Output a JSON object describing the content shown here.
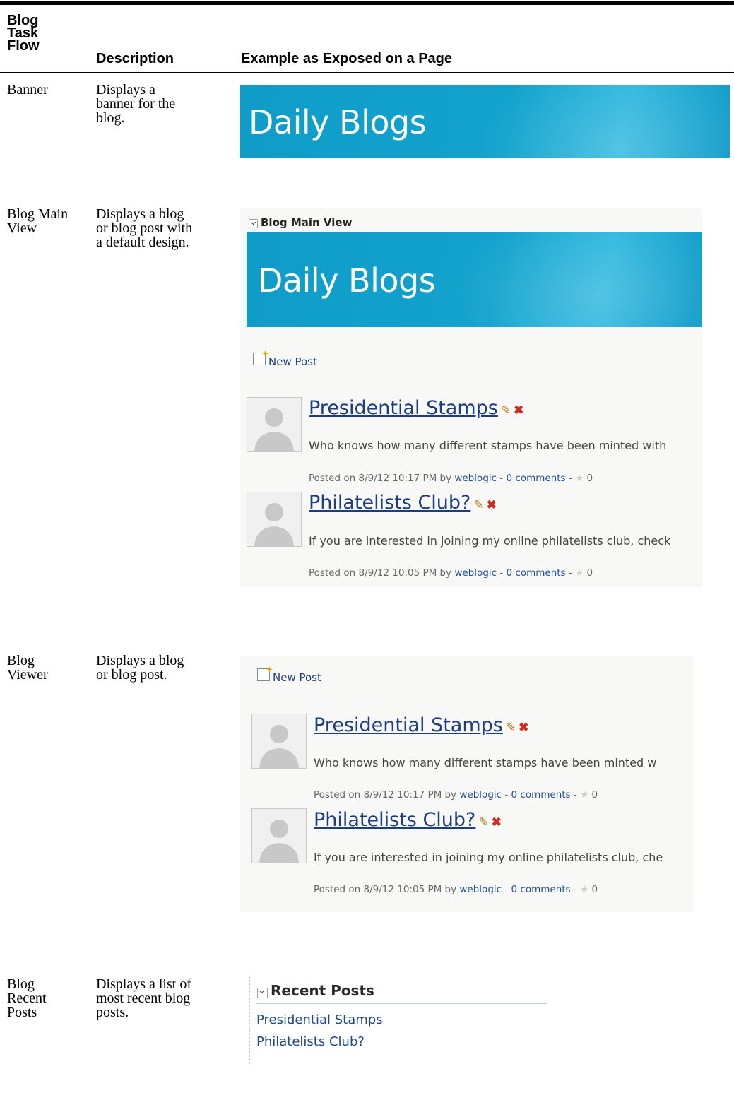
{
  "table": {
    "headers": {
      "col1": [
        "Blog",
        "Task",
        "Flow"
      ],
      "col2": "Description",
      "col3": "Example as Exposed on a Page"
    },
    "rows": [
      {
        "flow": [
          "Banner"
        ],
        "description": [
          "Displays a",
          "banner for the",
          "blog."
        ]
      },
      {
        "flow": [
          "Blog Main",
          "View"
        ],
        "description": [
          "Displays a blog",
          "or blog post with",
          "a default design."
        ]
      },
      {
        "flow": [
          "Blog",
          "Viewer"
        ],
        "description": [
          "Displays a blog",
          "or blog post."
        ]
      },
      {
        "flow": [
          "Blog",
          "Recent",
          "Posts"
        ],
        "description": [
          "Displays a list of",
          "most recent blog",
          "posts."
        ]
      }
    ]
  },
  "banner_example": {
    "title": "Daily Blogs"
  },
  "main_view_example": {
    "panel_title": "Blog Main View",
    "banner_title": "Daily Blogs",
    "new_post": "New Post",
    "posts": [
      {
        "title": "Presidential Stamps",
        "excerpt": "Who knows how many different stamps have been minted with",
        "posted": "Posted on 8/9/12 10:17 PM by ",
        "author": "weblogic",
        "sep1": " - ",
        "comments": "0 comments",
        "sep2": " - ",
        "rating": "0"
      },
      {
        "title": "Philatelists Club?",
        "excerpt": "If you are interested in joining my online philatelists club, check",
        "posted": "Posted on 8/9/12 10:05 PM by ",
        "author": "weblogic",
        "sep1": " - ",
        "comments": "0 comments",
        "sep2": " - ",
        "rating": "0"
      }
    ]
  },
  "viewer_example": {
    "new_post": "New Post",
    "posts": [
      {
        "title": "Presidential Stamps",
        "excerpt": "Who knows how many different stamps have been minted w",
        "posted": "Posted on 8/9/12 10:17 PM by ",
        "author": "weblogic",
        "sep1": " - ",
        "comments": "0 comments",
        "sep2": " - ",
        "rating": "0"
      },
      {
        "title": "Philatelists Club?",
        "excerpt": "If you are interested in joining my online philatelists club, che",
        "posted": "Posted on 8/9/12 10:05 PM by ",
        "author": "weblogic",
        "sep1": " - ",
        "comments": "0 comments",
        "sep2": " - ",
        "rating": "0"
      }
    ]
  },
  "recent_posts_example": {
    "panel_title": "Recent Posts",
    "links": [
      "Presidential Stamps",
      "Philatelists Club?"
    ]
  },
  "colors": {
    "banner": "#0f9cc8",
    "link": "#1b3c87",
    "panel_bg": "#f8f9f6"
  }
}
